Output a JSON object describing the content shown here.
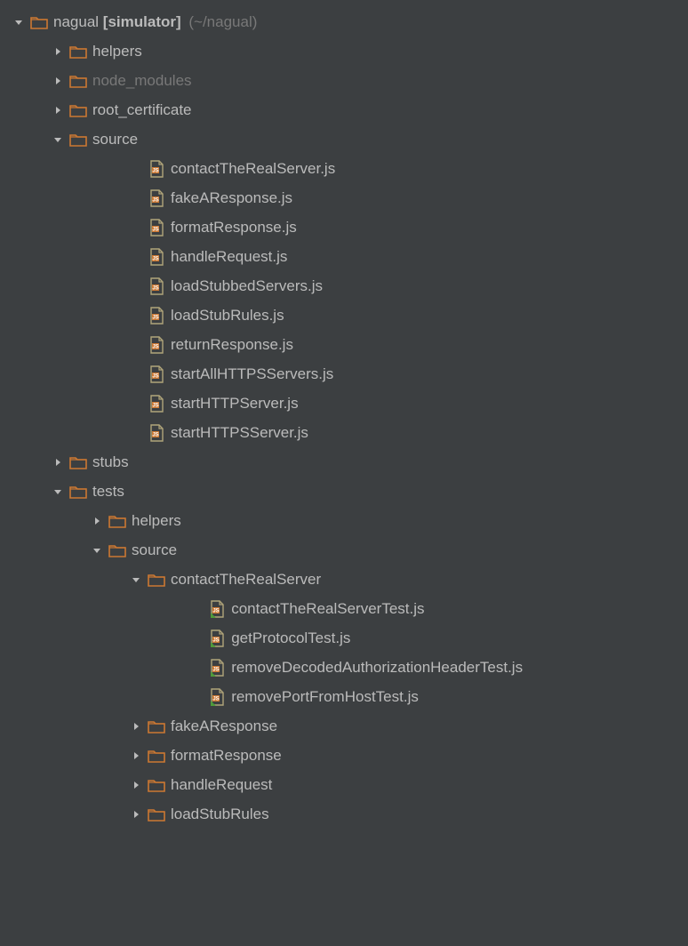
{
  "root": {
    "name": "nagual",
    "bracket": "[simulator]",
    "path": "(~/nagual)"
  },
  "helpers": "helpers",
  "node_modules": "node_modules",
  "root_certificate": "root_certificate",
  "source": "source",
  "source_files": {
    "f0": "contactTheRealServer.js",
    "f1": "fakeAResponse.js",
    "f2": "formatResponse.js",
    "f3": "handleRequest.js",
    "f4": "loadStubbedServers.js",
    "f5": "loadStubRules.js",
    "f6": "returnResponse.js",
    "f7": "startAllHTTPSServers.js",
    "f8": "startHTTPServer.js",
    "f9": "startHTTPSServer.js"
  },
  "stubs": "stubs",
  "tests": "tests",
  "tests_helpers": "helpers",
  "tests_source": "source",
  "tests_contact": "contactTheRealServer",
  "tests_contact_files": {
    "t0": "contactTheRealServerTest.js",
    "t1": "getProtocolTest.js",
    "t2": "removeDecodedAuthorizationHeaderTest.js",
    "t3": "removePortFromHostTest.js"
  },
  "tests_fake": "fakeAResponse",
  "tests_format": "formatResponse",
  "tests_handle": "handleRequest",
  "tests_loadstub": "loadStubRules"
}
